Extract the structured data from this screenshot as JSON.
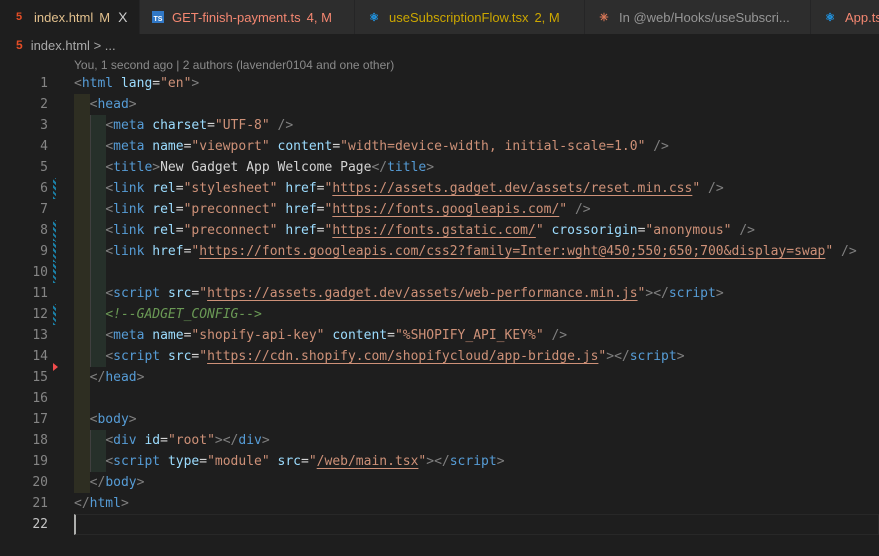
{
  "tabs": [
    {
      "label": "index.html",
      "status": "M",
      "color": "#e2c08d",
      "icon": "html5-icon",
      "iconColor": "#e44d26",
      "active": true,
      "close": "X"
    },
    {
      "label": "GET-finish-payment.ts",
      "status": "4, M",
      "color": "#f48771",
      "icon": "typescript-icon",
      "iconColor": "#3178c6"
    },
    {
      "label": "useSubscriptionFlow.tsx",
      "status": "2, M",
      "color": "#cca700",
      "icon": "react-icon",
      "iconColor": "#1f9cf0"
    },
    {
      "label": "In @web/Hooks/useSubscri...",
      "status": "",
      "color": "#969696",
      "icon": "claude-icon",
      "iconColor": "#d97757"
    },
    {
      "label": "App.ts",
      "status": "",
      "color": "#f48771",
      "icon": "react-icon",
      "iconColor": "#1f9cf0"
    }
  ],
  "breadcrumb": {
    "file": "index.html",
    "rest": "> ..."
  },
  "blame": "You, 1 second ago | 2 authors (lavender0104 and one other)",
  "gutter": {
    "modified": [
      6,
      8,
      9,
      10,
      12
    ],
    "deleted": [
      15
    ],
    "current": 22
  },
  "lines": [
    [
      [
        "p",
        "<"
      ],
      [
        "t",
        "html"
      ],
      [
        "x",
        " "
      ],
      [
        "a",
        "lang"
      ],
      [
        "x",
        "="
      ],
      [
        "s",
        "\"en\""
      ],
      [
        "p",
        ">"
      ]
    ],
    [
      [
        "x",
        "  "
      ],
      [
        "p",
        "<"
      ],
      [
        "t",
        "head"
      ],
      [
        "p",
        ">"
      ]
    ],
    [
      [
        "x",
        "    "
      ],
      [
        "p",
        "<"
      ],
      [
        "t",
        "meta"
      ],
      [
        "x",
        " "
      ],
      [
        "a",
        "charset"
      ],
      [
        "x",
        "="
      ],
      [
        "s",
        "\"UTF-8\""
      ],
      [
        "x",
        " "
      ],
      [
        "p",
        "/>"
      ]
    ],
    [
      [
        "x",
        "    "
      ],
      [
        "p",
        "<"
      ],
      [
        "t",
        "meta"
      ],
      [
        "x",
        " "
      ],
      [
        "a",
        "name"
      ],
      [
        "x",
        "="
      ],
      [
        "s",
        "\"viewport\""
      ],
      [
        "x",
        " "
      ],
      [
        "a",
        "content"
      ],
      [
        "x",
        "="
      ],
      [
        "s",
        "\"width=device-width, initial-scale=1.0\""
      ],
      [
        "x",
        " "
      ],
      [
        "p",
        "/>"
      ]
    ],
    [
      [
        "x",
        "    "
      ],
      [
        "p",
        "<"
      ],
      [
        "t",
        "title"
      ],
      [
        "p",
        ">"
      ],
      [
        "x",
        "New Gadget App Welcome Page"
      ],
      [
        "p",
        "</"
      ],
      [
        "t",
        "title"
      ],
      [
        "p",
        ">"
      ]
    ],
    [
      [
        "x",
        "    "
      ],
      [
        "p",
        "<"
      ],
      [
        "t",
        "link"
      ],
      [
        "x",
        " "
      ],
      [
        "a",
        "rel"
      ],
      [
        "x",
        "="
      ],
      [
        "s",
        "\"stylesheet\""
      ],
      [
        "x",
        " "
      ],
      [
        "a",
        "href"
      ],
      [
        "x",
        "="
      ],
      [
        "s",
        "\""
      ],
      [
        "u",
        "https://assets.gadget.dev/assets/reset.min.css"
      ],
      [
        "s",
        "\""
      ],
      [
        "x",
        " "
      ],
      [
        "p",
        "/>"
      ]
    ],
    [
      [
        "x",
        "    "
      ],
      [
        "p",
        "<"
      ],
      [
        "t",
        "link"
      ],
      [
        "x",
        " "
      ],
      [
        "a",
        "rel"
      ],
      [
        "x",
        "="
      ],
      [
        "s",
        "\"preconnect\""
      ],
      [
        "x",
        " "
      ],
      [
        "a",
        "href"
      ],
      [
        "x",
        "="
      ],
      [
        "s",
        "\""
      ],
      [
        "u",
        "https://fonts.googleapis.com/"
      ],
      [
        "s",
        "\""
      ],
      [
        "x",
        " "
      ],
      [
        "p",
        "/>"
      ]
    ],
    [
      [
        "x",
        "    "
      ],
      [
        "p",
        "<"
      ],
      [
        "t",
        "link"
      ],
      [
        "x",
        " "
      ],
      [
        "a",
        "rel"
      ],
      [
        "x",
        "="
      ],
      [
        "s",
        "\"preconnect\""
      ],
      [
        "x",
        " "
      ],
      [
        "a",
        "href"
      ],
      [
        "x",
        "="
      ],
      [
        "s",
        "\""
      ],
      [
        "u",
        "https://fonts.gstatic.com/"
      ],
      [
        "s",
        "\""
      ],
      [
        "x",
        " "
      ],
      [
        "a",
        "crossorigin"
      ],
      [
        "x",
        "="
      ],
      [
        "s",
        "\"anonymous\""
      ],
      [
        "x",
        " "
      ],
      [
        "p",
        "/>"
      ]
    ],
    [
      [
        "x",
        "    "
      ],
      [
        "p",
        "<"
      ],
      [
        "t",
        "link"
      ],
      [
        "x",
        " "
      ],
      [
        "a",
        "href"
      ],
      [
        "x",
        "="
      ],
      [
        "s",
        "\""
      ],
      [
        "u",
        "https://fonts.googleapis.com/css2?family=Inter:wght@450;550;650;700&display=swap"
      ],
      [
        "s",
        "\""
      ],
      [
        "x",
        " "
      ],
      [
        "p",
        "/>"
      ]
    ],
    [],
    [
      [
        "x",
        "    "
      ],
      [
        "p",
        "<"
      ],
      [
        "t",
        "script"
      ],
      [
        "x",
        " "
      ],
      [
        "a",
        "src"
      ],
      [
        "x",
        "="
      ],
      [
        "s",
        "\""
      ],
      [
        "u",
        "https://assets.gadget.dev/assets/web-performance.min.js"
      ],
      [
        "s",
        "\""
      ],
      [
        "p",
        "></"
      ],
      [
        "t",
        "script"
      ],
      [
        "p",
        ">"
      ]
    ],
    [
      [
        "x",
        "    "
      ],
      [
        "c",
        "<!--GADGET_CONFIG-->"
      ]
    ],
    [
      [
        "x",
        "    "
      ],
      [
        "p",
        "<"
      ],
      [
        "t",
        "meta"
      ],
      [
        "x",
        " "
      ],
      [
        "a",
        "name"
      ],
      [
        "x",
        "="
      ],
      [
        "s",
        "\"shopify-api-key\""
      ],
      [
        "x",
        " "
      ],
      [
        "a",
        "content"
      ],
      [
        "x",
        "="
      ],
      [
        "s",
        "\"%SHOPIFY_API_KEY%\""
      ],
      [
        "x",
        " "
      ],
      [
        "p",
        "/>"
      ]
    ],
    [
      [
        "x",
        "    "
      ],
      [
        "p",
        "<"
      ],
      [
        "t",
        "script"
      ],
      [
        "x",
        " "
      ],
      [
        "a",
        "src"
      ],
      [
        "x",
        "="
      ],
      [
        "s",
        "\""
      ],
      [
        "u",
        "https://cdn.shopify.com/shopifycloud/app-bridge.js"
      ],
      [
        "s",
        "\""
      ],
      [
        "p",
        "></"
      ],
      [
        "t",
        "script"
      ],
      [
        "p",
        ">"
      ]
    ],
    [
      [
        "x",
        "  "
      ],
      [
        "p",
        "</"
      ],
      [
        "t",
        "head"
      ],
      [
        "p",
        ">"
      ]
    ],
    [],
    [
      [
        "x",
        "  "
      ],
      [
        "p",
        "<"
      ],
      [
        "t",
        "body"
      ],
      [
        "p",
        ">"
      ]
    ],
    [
      [
        "x",
        "    "
      ],
      [
        "p",
        "<"
      ],
      [
        "t",
        "div"
      ],
      [
        "x",
        " "
      ],
      [
        "a",
        "id"
      ],
      [
        "x",
        "="
      ],
      [
        "s",
        "\"root\""
      ],
      [
        "p",
        "></"
      ],
      [
        "t",
        "div"
      ],
      [
        "p",
        ">"
      ]
    ],
    [
      [
        "x",
        "    "
      ],
      [
        "p",
        "<"
      ],
      [
        "t",
        "script"
      ],
      [
        "x",
        " "
      ],
      [
        "a",
        "type"
      ],
      [
        "x",
        "="
      ],
      [
        "s",
        "\"module\""
      ],
      [
        "x",
        " "
      ],
      [
        "a",
        "src"
      ],
      [
        "x",
        "="
      ],
      [
        "s",
        "\""
      ],
      [
        "u",
        "/web/main.tsx"
      ],
      [
        "s",
        "\""
      ],
      [
        "p",
        "></"
      ],
      [
        "t",
        "script"
      ],
      [
        "p",
        ">"
      ]
    ],
    [
      [
        "x",
        "  "
      ],
      [
        "p",
        "</"
      ],
      [
        "t",
        "body"
      ],
      [
        "p",
        ">"
      ]
    ],
    [
      [
        "p",
        "</"
      ],
      [
        "t",
        "html"
      ],
      [
        "p",
        ">"
      ]
    ],
    []
  ]
}
